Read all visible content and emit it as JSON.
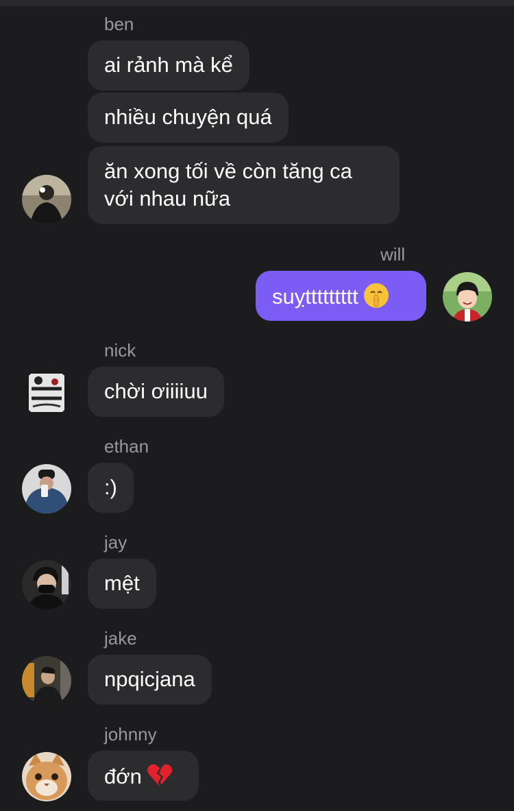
{
  "messages": [
    {
      "sender": "ben",
      "lines": [
        "ai rảnh mà kể",
        "nhiều chuyện quá",
        "ăn xong tối về còn tăng ca với nhau nữa"
      ]
    },
    {
      "sender": "will",
      "text": "suỵttttttttt",
      "emoji": "shushing-face"
    },
    {
      "sender": "nick",
      "text": "chời ơiiiiuu"
    },
    {
      "sender": "ethan",
      "text": ":)"
    },
    {
      "sender": "jay",
      "text": "mệt"
    },
    {
      "sender": "jake",
      "text": "npqicjana"
    },
    {
      "sender": "johnny",
      "text": "đớn",
      "emoji": "broken-heart"
    }
  ],
  "colors": {
    "background": "#1c1c1e",
    "incoming_bubble": "#2c2c2e",
    "outgoing_bubble": "#7b5cf5",
    "name_text": "#98989f"
  }
}
